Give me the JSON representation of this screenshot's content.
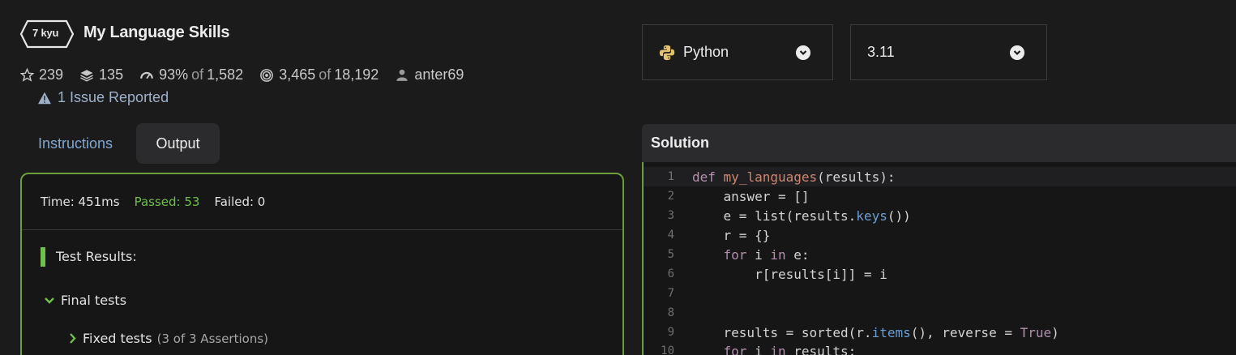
{
  "kata": {
    "rank": "7 kyu",
    "title": "My Language Skills"
  },
  "stats": {
    "stars": "239",
    "collections": "135",
    "satisfaction": "93%",
    "satisfaction_of": "of",
    "satisfaction_votes": "1,582",
    "completions": "3,465",
    "completions_of": "of",
    "completions_total": "18,192",
    "author": "anter69",
    "issues": "1 Issue Reported"
  },
  "tabs": {
    "instructions": "Instructions",
    "output": "Output"
  },
  "output": {
    "time": "Time: 451ms",
    "passed": "Passed: 53",
    "failed": "Failed: 0",
    "results_label": "Test Results:",
    "final_tests": "Final tests",
    "fixed_tests": "Fixed tests",
    "fixed_assertions": "(3 of 3 Assertions)"
  },
  "language_select": {
    "value": "Python"
  },
  "version_select": {
    "value": "3.11"
  },
  "editor": {
    "title": "Solution",
    "line_numbers": [
      "1",
      "2",
      "3",
      "4",
      "5",
      "6",
      "7",
      "8",
      "9",
      "10"
    ]
  },
  "colors": {
    "accent_green": "#6fbf4a",
    "panel_border": "#6f9c3b",
    "link_blue": "#7fa8d6"
  },
  "icons": {
    "stars": "star-icon",
    "collections": "layers-icon",
    "satisfaction": "speedometer-icon",
    "completions": "target-icon",
    "author": "user-icon",
    "issues": "warning-icon",
    "language": "python-icon",
    "caret": "chevron-down-icon"
  }
}
